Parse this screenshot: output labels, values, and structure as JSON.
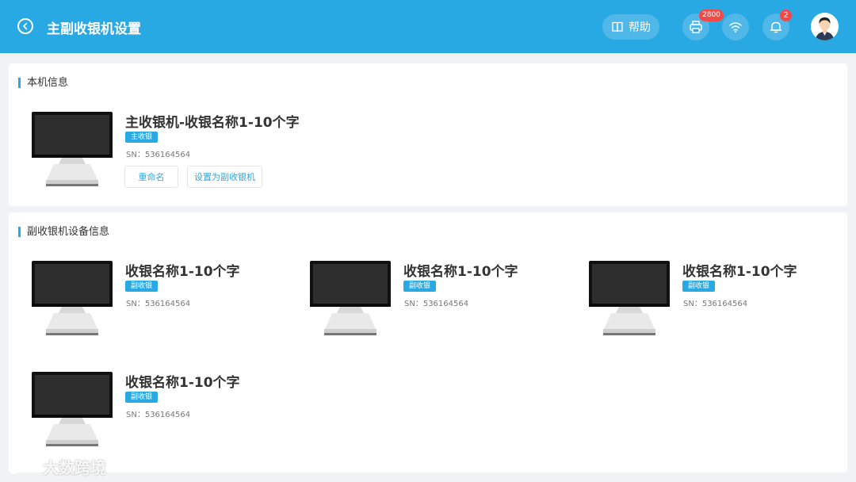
{
  "header": {
    "title": "主副收银机设置",
    "help_label": "帮助",
    "printer_badge": "2800",
    "notification_badge": "2"
  },
  "local": {
    "section_title": "本机信息",
    "device": {
      "name": "主收银机-收银名称1-10个字",
      "tag": "主收银",
      "sn": "SN：536164564"
    },
    "rename_label": "重命名",
    "set_secondary_label": "设置为副收银机"
  },
  "secondary": {
    "section_title": "副收银机设备信息",
    "devices": [
      {
        "name": "收银名称1-10个字",
        "tag": "副收银",
        "sn": "SN：536164564"
      },
      {
        "name": "收银名称1-10个字",
        "tag": "副收银",
        "sn": "SN：536164564"
      },
      {
        "name": "收银名称1-10个字",
        "tag": "副收银",
        "sn": "SN：536164564"
      },
      {
        "name": "收银名称1-10个字",
        "tag": "副收银",
        "sn": "SN：536164564"
      }
    ]
  },
  "watermark": "大数跨境",
  "colors": {
    "accent": "#29a9e3",
    "badge": "#f04a4a",
    "background": "#f0f2f5"
  },
  "icons": [
    "back-icon",
    "book-icon",
    "printer-icon",
    "wifi-icon",
    "bell-icon",
    "avatar",
    "monitor-icon"
  ]
}
